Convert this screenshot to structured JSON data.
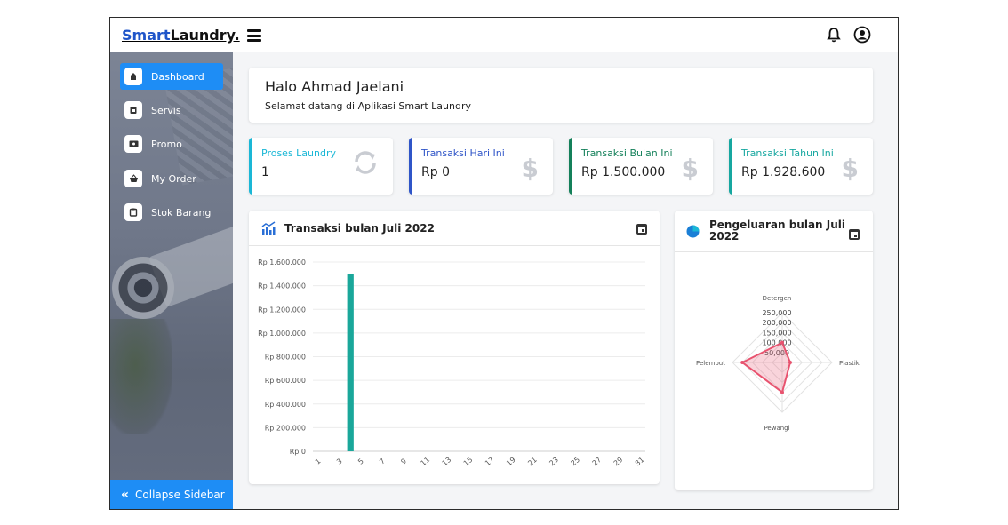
{
  "brand": {
    "part1": "Smart",
    "part2": "Laundry."
  },
  "topbar": {
    "bell_icon": "bell-icon",
    "user_icon": "user-circle-icon"
  },
  "sidebar": {
    "items": [
      {
        "label": "Dashboard",
        "icon": "home-icon",
        "active": true
      },
      {
        "label": "Servis",
        "icon": "servis-icon",
        "active": false
      },
      {
        "label": "Promo",
        "icon": "ticket-icon",
        "active": false
      },
      {
        "label": "My Order",
        "icon": "basket-icon",
        "active": false
      },
      {
        "label": "Stok Barang",
        "icon": "box-icon",
        "active": false
      }
    ],
    "collapse_label": "Collapse Sidebar"
  },
  "welcome": {
    "title": "Halo Ahmad Jaelani",
    "subtitle": "Selamat datang di Aplikasi Smart Laundry"
  },
  "stats": [
    {
      "label": "Proses Laundry",
      "value": "1",
      "color": "#1ab7d6",
      "icon": "sync-icon"
    },
    {
      "label": "Transaksi Hari Ini",
      "value": "Rp 0",
      "color": "#2f55c8",
      "icon": "dollar-icon"
    },
    {
      "label": "Transaksi Bulan Ini",
      "value": "Rp 1.500.000",
      "color": "#14805a",
      "icon": "dollar-icon"
    },
    {
      "label": "Transaksi Tahun Ini",
      "value": "Rp 1.928.600",
      "color": "#16a7a0",
      "icon": "dollar-icon"
    }
  ],
  "bar_panel": {
    "title": "Transaksi bulan Juli 2022"
  },
  "radar_panel": {
    "title_line1": "Pengeluaran bulan Juli",
    "title_line2": "2022"
  },
  "chart_data": [
    {
      "type": "bar",
      "title": "Transaksi bulan Juli 2022",
      "y_ticks": [
        "Rp 0",
        "Rp 200.000",
        "Rp 400.000",
        "Rp 600.000",
        "Rp 800.000",
        "Rp 1.000.000",
        "Rp 1.200.000",
        "Rp 1.400.000",
        "Rp 1.600.000"
      ],
      "x_ticks": [
        "1",
        "3",
        "5",
        "7",
        "9",
        "11",
        "13",
        "15",
        "17",
        "19",
        "21",
        "23",
        "25",
        "27",
        "29",
        "31"
      ],
      "ylim": [
        0,
        1600000
      ],
      "days": 31,
      "values": [
        {
          "day": 4,
          "value": 1500000
        }
      ],
      "color": "#1aa79a",
      "grid": true
    },
    {
      "type": "radar",
      "title": "Pengeluaran bulan Juli 2022",
      "axes": [
        "Detergen",
        "Plastik",
        "Pewangi",
        "Pelembut"
      ],
      "r_ticks": [
        "50,000",
        "100,000",
        "150,000",
        "200,000",
        "250,000"
      ],
      "rmax": 250000,
      "values": [
        100000,
        40000,
        150000,
        200000
      ],
      "color": "#e8536f"
    }
  ]
}
